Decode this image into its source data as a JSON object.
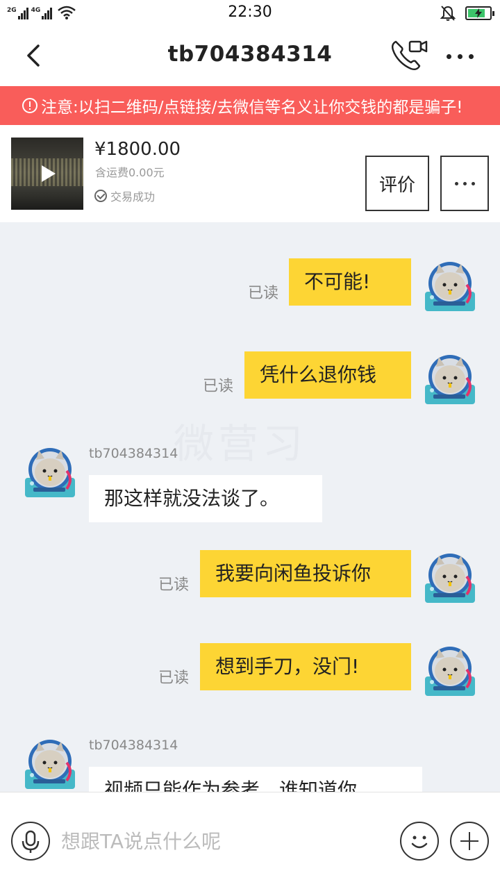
{
  "status_bar": {
    "time": "22:30",
    "network_1": "2G",
    "network_2": "4G",
    "battery_level": 0.8,
    "icons": [
      "signal-icon",
      "wifi-icon",
      "bell-off-icon",
      "battery-icon"
    ]
  },
  "header": {
    "title": "tb704384314",
    "icons": [
      "back-icon",
      "phone-video-icon",
      "more-icon"
    ]
  },
  "warning": {
    "text": "注意:以扫二维码/点链接/去微信等名义让你交钱的都是骗子!",
    "color": "#f95d5a"
  },
  "item": {
    "price": "¥1800.00",
    "shipping": "含运费0.00元",
    "status": "交易成功",
    "rate_label": "评价"
  },
  "chat": {
    "watermark": "微营习",
    "read_label": "已读",
    "messages": [
      {
        "from": "me",
        "text": "不可能!",
        "status": "已读"
      },
      {
        "from": "me",
        "text": "凭什么退你钱",
        "status": "已读"
      },
      {
        "from": "other",
        "sender": "tb704384314",
        "text": "那这样就没法谈了。"
      },
      {
        "from": "me",
        "text": "我要向闲鱼投诉你",
        "status": "已读"
      },
      {
        "from": "me",
        "text": "想到手刀，没门!",
        "status": "已读"
      },
      {
        "from": "other",
        "sender": "tb704384314",
        "text": "视频只能作为参考，谁知道你"
      }
    ],
    "colors": {
      "mine_bubble": "#fdd534",
      "theirs_bubble": "#ffffff",
      "background": "#eef1f5"
    }
  },
  "input": {
    "placeholder": "想跟TA说点什么呢",
    "icons": [
      "mic-icon",
      "emoji-icon",
      "plus-icon"
    ]
  }
}
